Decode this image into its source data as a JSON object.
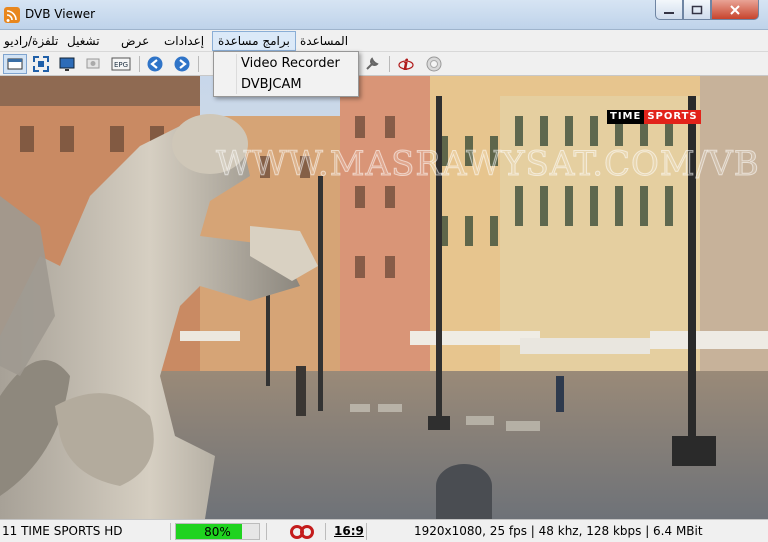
{
  "window": {
    "title": "DVB Viewer"
  },
  "menu": {
    "items": [
      "المساعدة",
      "برامج مساعدة",
      "إعدادات",
      "عرض",
      "تشغيل",
      "تلفزة/راديو"
    ]
  },
  "dropdown": {
    "items": [
      "Video Recorder",
      "DVBJCAM"
    ]
  },
  "video": {
    "watermark": "WWW.MASRAWYSAT.COM/VB",
    "channel_logo_a": "TIME",
    "channel_logo_b": "SPORTS"
  },
  "status": {
    "channel": "11 TIME SPORTS HD",
    "signal_value": 0.8,
    "signal_label": "80%",
    "aspect": "16:9",
    "stream_info": "1920x1080, 25 fps | 48 khz, 128 kbps | 6.4 MBit"
  },
  "colors": {
    "signal_fill": "#1fd31f",
    "menu_highlight": "#dbe9f8",
    "window_close": "#c7442d",
    "logo_red": "#e2231a"
  },
  "icons": {
    "app": "dvbviewer-icon",
    "toolbar": [
      "window-icon",
      "fullscreen-icon",
      "desktop-icon",
      "osd-icon",
      "epg-icon",
      "back-icon",
      "forward-icon",
      "settings-icon",
      "info-icon",
      "record-icon"
    ]
  }
}
